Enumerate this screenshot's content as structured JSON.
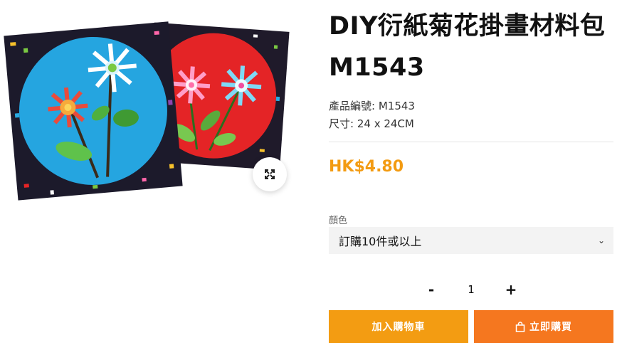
{
  "product": {
    "title": "DIY衍紙菊花掛畫材料包 M1543",
    "meta": {
      "sku_label": "產品編號:",
      "sku_value": "M1543",
      "size_label": "尺寸:",
      "size_value": "24 x 24CM"
    },
    "price": "HK$4.80",
    "variant": {
      "label": "顏色",
      "selected": "訂購10件或以上"
    },
    "quantity": {
      "minus": "-",
      "value": "1",
      "plus": "+"
    },
    "buttons": {
      "add_to_cart": "加入購物車",
      "buy_now": "立即購買"
    }
  },
  "icons": {
    "zoom": "expand-icon",
    "select": "chevron-down-icon",
    "buy": "shopping-bag-icon"
  },
  "colors": {
    "price": "#f39b12",
    "add_to_cart_bg": "#f39c12",
    "buy_now_bg": "#f5771f",
    "select_bg": "#f3f3f3"
  }
}
